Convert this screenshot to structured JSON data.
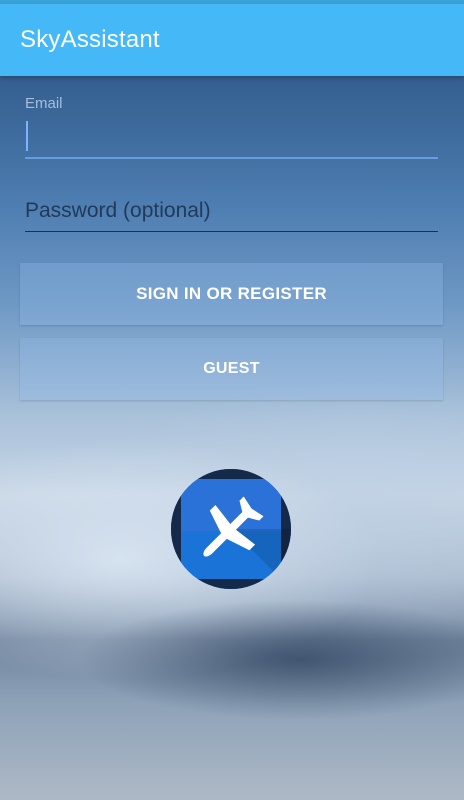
{
  "app_bar": {
    "title": "SkyAssistant",
    "color": "#45b8f8"
  },
  "form": {
    "email": {
      "label": "Email",
      "value": ""
    },
    "password": {
      "placeholder": "Password (optional)",
      "value": ""
    }
  },
  "buttons": {
    "sign_in_label": "SIGN IN OR REGISTER",
    "guest_label": "GUEST"
  },
  "logo": {
    "icon": "airplane-icon",
    "background_color": "#1976d2"
  }
}
